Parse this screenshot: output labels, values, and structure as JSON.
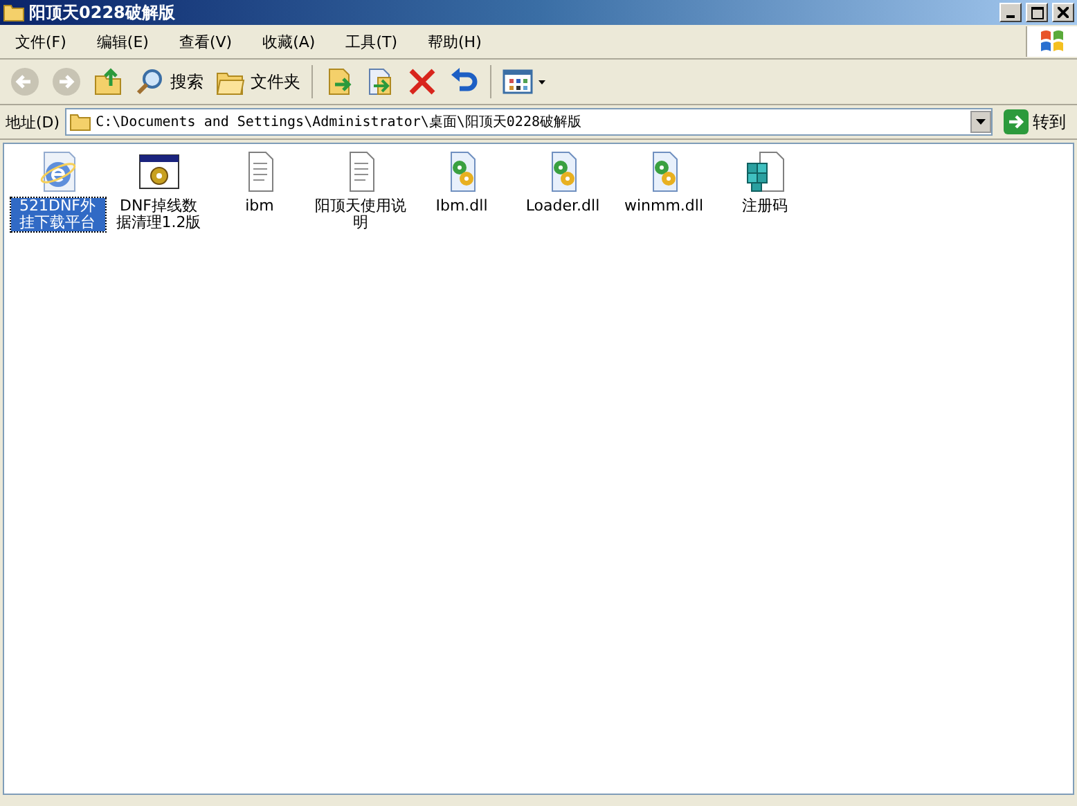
{
  "window": {
    "title": "阳顶天0228破解版"
  },
  "menu": [
    "文件(F)",
    "编辑(E)",
    "查看(V)",
    "收藏(A)",
    "工具(T)",
    "帮助(H)"
  ],
  "toolbar": [
    {
      "kind": "back"
    },
    {
      "kind": "forward"
    },
    {
      "kind": "up"
    },
    {
      "kind": "search",
      "label": "搜索"
    },
    {
      "kind": "folders",
      "label": "文件夹"
    },
    {
      "kind": "sep"
    },
    {
      "kind": "move"
    },
    {
      "kind": "copy"
    },
    {
      "kind": "delete"
    },
    {
      "kind": "undo"
    },
    {
      "kind": "sep"
    },
    {
      "kind": "views"
    }
  ],
  "address": {
    "label": "地址(D)",
    "value": "C:\\Documents and Settings\\Administrator\\桌面\\阳顶天0228破解版",
    "go": "转到"
  },
  "files": [
    {
      "name": "521DNF外挂下载平台",
      "kind": "ie",
      "selected": true
    },
    {
      "name": "DNF掉线数据清理1.2版",
      "kind": "exe",
      "selected": false
    },
    {
      "name": "ibm",
      "kind": "txt",
      "selected": false
    },
    {
      "name": "阳顶天使用说明",
      "kind": "txt",
      "selected": false
    },
    {
      "name": "Ibm.dll",
      "kind": "dll",
      "selected": false
    },
    {
      "name": "Loader.dll",
      "kind": "dll",
      "selected": false
    },
    {
      "name": "winmm.dll",
      "kind": "dll",
      "selected": false
    },
    {
      "name": "注册码",
      "kind": "reg",
      "selected": false
    }
  ]
}
